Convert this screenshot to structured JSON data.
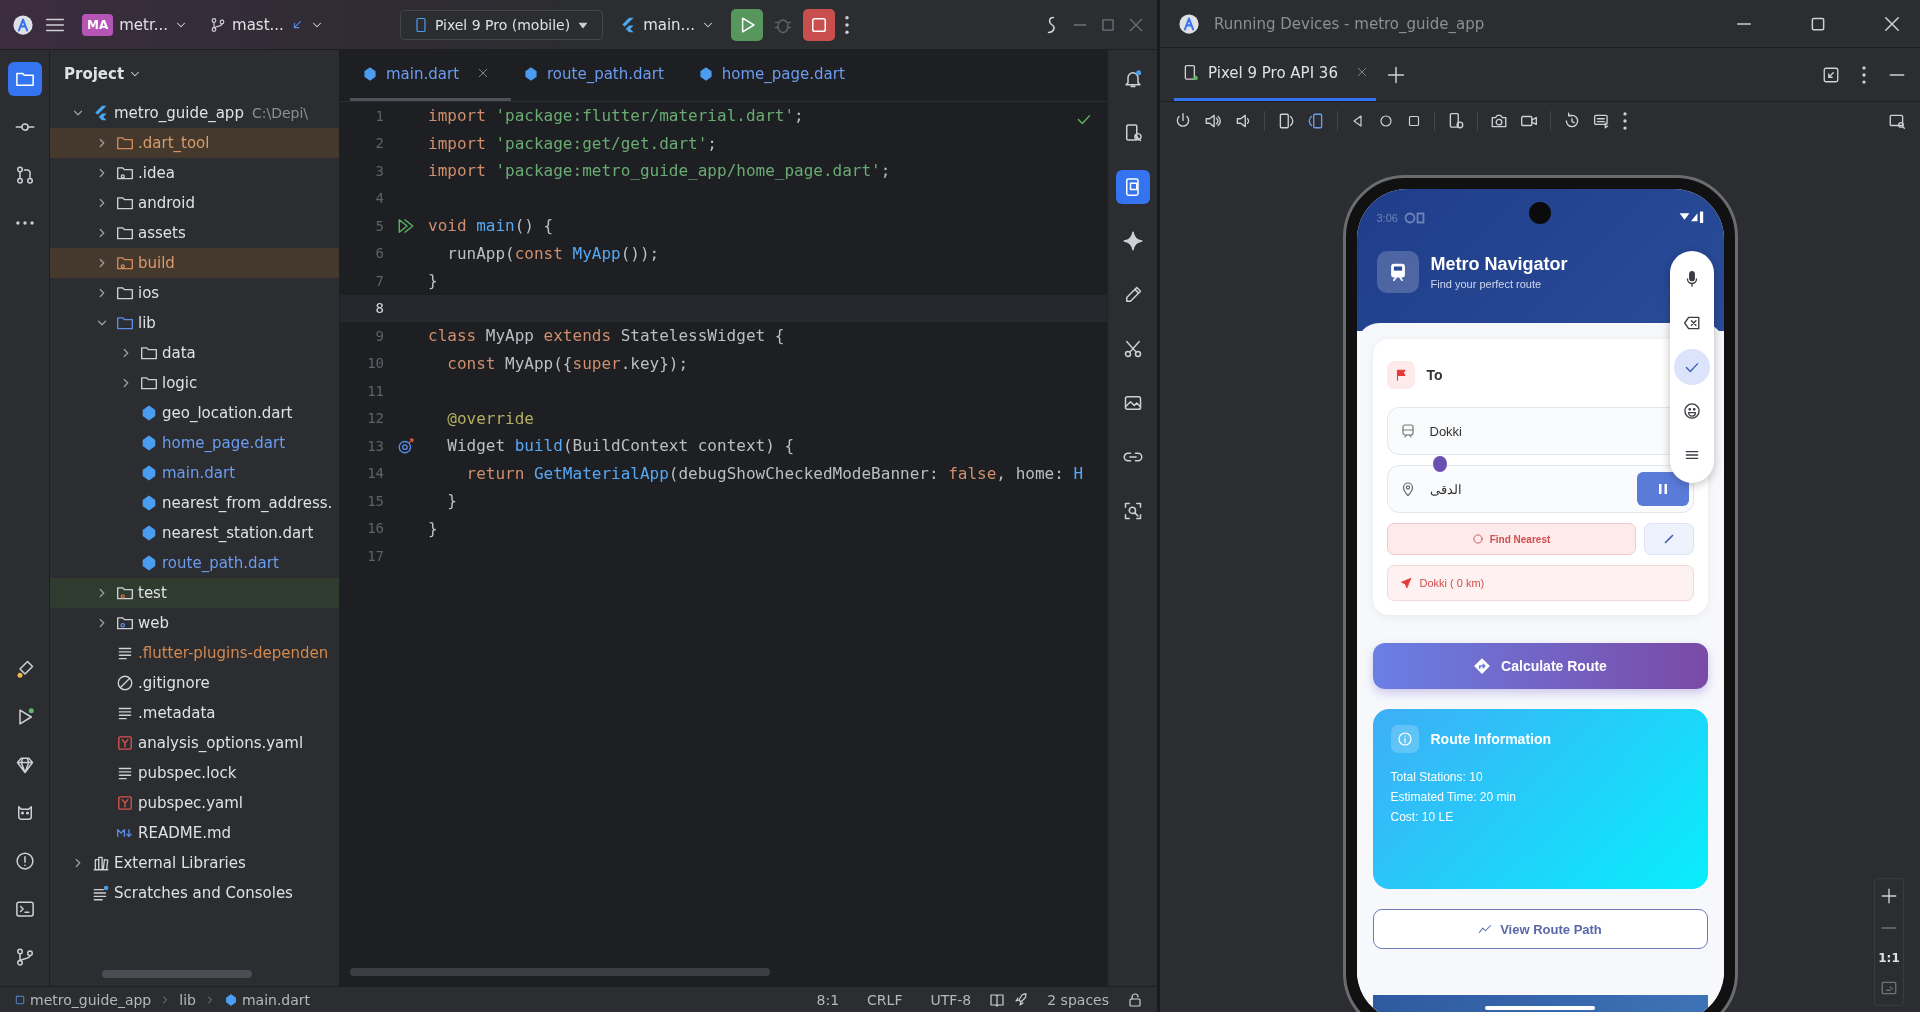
{
  "ide": {
    "toolbar": {
      "project_badge": "MA",
      "project": "metr...",
      "branch": "mast...",
      "device": "Pixel 9 Pro (mobile)",
      "run_config": "main..."
    },
    "left_tools": [
      {
        "kind": "project",
        "selected": true
      },
      {
        "kind": "commit",
        "selected": false
      },
      {
        "kind": "pull-requests",
        "selected": false
      },
      {
        "kind": "more",
        "selected": false
      }
    ],
    "left_tools_bottom": [
      {
        "kind": "inspector",
        "selected": false
      },
      {
        "kind": "run",
        "selected": false
      },
      {
        "kind": "gem",
        "selected": false
      },
      {
        "kind": "logcat",
        "selected": false
      },
      {
        "kind": "problems",
        "selected": false
      },
      {
        "kind": "terminal",
        "selected": false
      },
      {
        "kind": "git",
        "selected": false
      }
    ],
    "right_tools": [
      {
        "kind": "notifications",
        "selected": false
      },
      {
        "kind": "device-manager",
        "selected": false
      },
      {
        "kind": "running-devices",
        "selected": true
      },
      {
        "kind": "gemini",
        "selected": false
      },
      {
        "kind": "pen",
        "selected": false
      },
      {
        "kind": "tools",
        "selected": false
      },
      {
        "kind": "screenshot",
        "selected": false
      },
      {
        "kind": "link",
        "selected": false
      },
      {
        "kind": "inspect",
        "selected": false
      }
    ],
    "project_panel": {
      "title": "Project",
      "tree": [
        {
          "label": "metro_guide_app",
          "hint": "C:\\Depi\\",
          "kind": "project",
          "expanded": true,
          "children": [
            {
              "label": ".dart_tool",
              "kind": "excluded-folder",
              "expanded": false
            },
            {
              "label": ".idea",
              "kind": "config-folder",
              "expanded": false
            },
            {
              "label": "android",
              "kind": "folder",
              "expanded": false
            },
            {
              "label": "assets",
              "kind": "folder",
              "expanded": false
            },
            {
              "label": "build",
              "kind": "excluded-config-folder",
              "expanded": false
            },
            {
              "label": "ios",
              "kind": "folder",
              "expanded": false
            },
            {
              "label": "lib",
              "kind": "source-folder",
              "expanded": true,
              "children": [
                {
                  "label": "data",
                  "kind": "folder",
                  "expanded": false
                },
                {
                  "label": "logic",
                  "kind": "folder",
                  "expanded": false
                },
                {
                  "label": "geo_location.dart",
                  "kind": "dart"
                },
                {
                  "label": "home_page.dart",
                  "kind": "modified-dart"
                },
                {
                  "label": "main.dart",
                  "kind": "modified-dart"
                },
                {
                  "label": "nearest_from_address.",
                  "kind": "dart"
                },
                {
                  "label": "nearest_station.dart",
                  "kind": "dart"
                },
                {
                  "label": "route_path.dart",
                  "kind": "modified-dart"
                }
              ]
            },
            {
              "label": "test",
              "kind": "test-folder",
              "expanded": false
            },
            {
              "label": "web",
              "kind": "web-folder",
              "expanded": false
            },
            {
              "label": ".flutter-plugins-dependen",
              "kind": "ignored-text"
            },
            {
              "label": ".gitignore",
              "kind": "ignore"
            },
            {
              "label": ".metadata",
              "kind": "text"
            },
            {
              "label": "analysis_options.yaml",
              "kind": "yaml"
            },
            {
              "label": "pubspec.lock",
              "kind": "text"
            },
            {
              "label": "pubspec.yaml",
              "kind": "yaml"
            },
            {
              "label": "README.md",
              "kind": "markdown"
            }
          ]
        },
        {
          "label": "External Libraries",
          "kind": "library",
          "expanded": false
        },
        {
          "label": "Scratches and Consoles",
          "kind": "scratch"
        }
      ]
    },
    "editor": {
      "tabs": [
        {
          "label": "main.dart",
          "selected": true
        },
        {
          "label": "route_path.dart",
          "selected": false
        },
        {
          "label": "home_page.dart",
          "selected": false
        }
      ],
      "lines": [
        {
          "number": "1",
          "current": false,
          "tokens": [
            {
              "text": "import ",
              "kind": "keyword"
            },
            {
              "text": "'package:flutter/material.dart'",
              "kind": "string"
            },
            {
              "text": ";",
              "kind": "plain"
            }
          ]
        },
        {
          "number": "2",
          "current": false,
          "tokens": [
            {
              "text": "import ",
              "kind": "keyword"
            },
            {
              "text": "'package:get/get.dart'",
              "kind": "string"
            },
            {
              "text": ";",
              "kind": "plain"
            }
          ]
        },
        {
          "number": "3",
          "current": false,
          "tokens": [
            {
              "text": "import ",
              "kind": "keyword"
            },
            {
              "text": "'package:metro_guide_app/home_page.dart'",
              "kind": "string"
            },
            {
              "text": ";",
              "kind": "plain"
            }
          ]
        },
        {
          "number": "4",
          "current": false
        },
        {
          "number": "5",
          "current": false,
          "kind": "run",
          "tokens": [
            {
              "text": "void ",
              "kind": "keyword"
            },
            {
              "text": "main",
              "kind": "function"
            },
            {
              "text": "() {",
              "kind": "plain"
            }
          ]
        },
        {
          "number": "6",
          "current": false,
          "tokens": [
            {
              "text": "  runApp(",
              "kind": "plain"
            },
            {
              "text": "const ",
              "kind": "keyword"
            },
            {
              "text": "MyApp",
              "kind": "function"
            },
            {
              "text": "());",
              "kind": "plain"
            }
          ]
        },
        {
          "number": "7",
          "current": false,
          "tokens": [
            {
              "text": "}",
              "kind": "plain"
            }
          ]
        },
        {
          "number": "8",
          "current": true
        },
        {
          "number": "9",
          "current": false,
          "tokens": [
            {
              "text": "class ",
              "kind": "keyword"
            },
            {
              "text": "MyApp ",
              "kind": "plain"
            },
            {
              "text": "extends ",
              "kind": "keyword"
            },
            {
              "text": "StatelessWidget {",
              "kind": "plain"
            }
          ]
        },
        {
          "number": "10",
          "current": false,
          "tokens": [
            {
              "text": "  const ",
              "kind": "keyword"
            },
            {
              "text": "MyApp({",
              "kind": "plain"
            },
            {
              "text": "super",
              "kind": "keyword"
            },
            {
              "text": ".key});",
              "kind": "plain"
            }
          ]
        },
        {
          "number": "11",
          "current": false
        },
        {
          "number": "12",
          "current": false,
          "tokens": [
            {
              "text": "  @override",
              "kind": "annotation"
            }
          ]
        },
        {
          "number": "13",
          "current": false,
          "kind": "override",
          "tokens": [
            {
              "text": "  Widget ",
              "kind": "plain"
            },
            {
              "text": "build",
              "kind": "function"
            },
            {
              "text": "(BuildContext context) {",
              "kind": "plain"
            }
          ]
        },
        {
          "number": "14",
          "current": false,
          "tokens": [
            {
              "text": "    return ",
              "kind": "keyword"
            },
            {
              "text": "GetMaterialApp",
              "kind": "function"
            },
            {
              "text": "(debugShowCheckedModeBanner: ",
              "kind": "plain"
            },
            {
              "text": "false",
              "kind": "keyword"
            },
            {
              "text": ", home: ",
              "kind": "plain"
            },
            {
              "text": "H",
              "kind": "function"
            }
          ]
        },
        {
          "number": "15",
          "current": false,
          "tokens": [
            {
              "text": "  }",
              "kind": "plain"
            }
          ]
        },
        {
          "number": "16",
          "current": false,
          "tokens": [
            {
              "text": "}",
              "kind": "plain"
            }
          ]
        },
        {
          "number": "17",
          "current": false
        }
      ]
    },
    "status_bar": {
      "breadcrumbs": [
        {
          "label": "metro_guide_app",
          "kind": "module"
        },
        {
          "label": "lib",
          "kind": "folder"
        },
        {
          "label": "main.dart",
          "kind": "dart"
        }
      ],
      "position": "8:1",
      "line_ending": "CRLF",
      "encoding": "UTF-8",
      "indent": "2 spaces"
    }
  },
  "running_devices": {
    "title": "Running Devices - metro_guide_app",
    "tabs": [
      {
        "label": "Pixel 9 Pro API 36",
        "selected": true
      }
    ],
    "zoom_label": "1:1",
    "app": {
      "status_time": "3:06",
      "title": "Metro Navigator",
      "subtitle": "Find your perfect route",
      "destination_label": "To",
      "station": "Dokki",
      "address": "الدقى",
      "find_nearest": "Find Nearest",
      "nearest_result": "Dokki ( 0 km)",
      "calculate": "Calculate Route",
      "route_info": {
        "title": "Route Information",
        "lines": [
          "Total Stations: 10",
          "Estimated Time: 20 min",
          "Cost: 10 LE"
        ]
      },
      "view_path": "View Route Path",
      "keyboard_tools": [
        {
          "kind": "mic",
          "selected": false
        },
        {
          "kind": "backspace",
          "selected": false
        },
        {
          "kind": "done",
          "selected": true
        },
        {
          "kind": "emoji",
          "selected": false
        },
        {
          "kind": "menu",
          "selected": false
        }
      ]
    }
  }
}
